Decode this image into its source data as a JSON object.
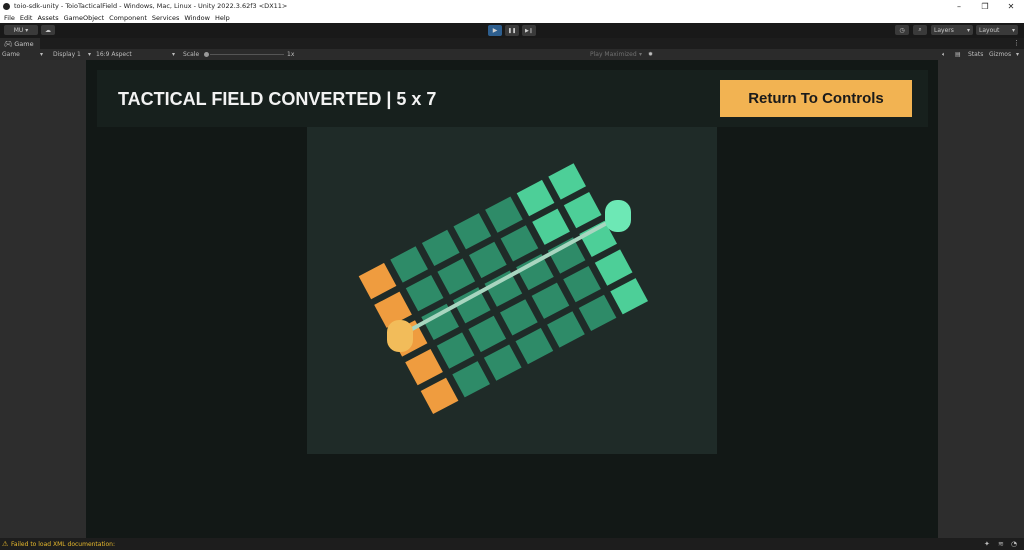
{
  "window": {
    "title": "toio-sdk-unity - ToioTacticalField - Windows, Mac, Linux - Unity 2022.3.62f3 <DX11>",
    "minimize": "–",
    "maximize": "❐",
    "close": "✕"
  },
  "menu": [
    "File",
    "Edit",
    "Assets",
    "GameObject",
    "Component",
    "Services",
    "Window",
    "Help"
  ],
  "toolbar": {
    "account_label": "MU ▾",
    "play_icon": "▶",
    "pause_icon": "❚❚",
    "step_icon": "▶❙",
    "layers_label": "Layers",
    "layout_label": "Layout",
    "more_icon": "⋮"
  },
  "game_tab": {
    "label": "Game",
    "more_icon": "⋮"
  },
  "game_toolbar": {
    "view_label": "Game",
    "display_label": "Display 1",
    "aspect_label": "16:9 Aspect",
    "scale_label": "Scale",
    "scale_value": "1x",
    "play_mode_label": "Play Maximized",
    "stats_label": "Stats",
    "gizmos_label": "Gizmos"
  },
  "game": {
    "title": "TACTICAL FIELD CONVERTED | 5 x 7",
    "return_button": "Return To Controls",
    "grid": {
      "rows": 5,
      "cols": 7,
      "orange_cells": [
        [
          0,
          0
        ],
        [
          1,
          0
        ],
        [
          2,
          0
        ],
        [
          3,
          0
        ],
        [
          4,
          0
        ]
      ],
      "mint_cells": [
        [
          0,
          6
        ],
        [
          1,
          6
        ],
        [
          2,
          6
        ],
        [
          3,
          6
        ],
        [
          4,
          6
        ],
        [
          0,
          5
        ],
        [
          1,
          5
        ]
      ],
      "colors": {
        "green": "#2e8b68",
        "orange": "#ef9c3f",
        "mint": "#4dcf98",
        "robot_yellow": "#f2bc5a",
        "robot_mint": "#6de8b5",
        "line": "#a8d6c0"
      }
    }
  },
  "status": {
    "warning_icon": "⚠",
    "message": "Failed to load XML documentation:"
  }
}
